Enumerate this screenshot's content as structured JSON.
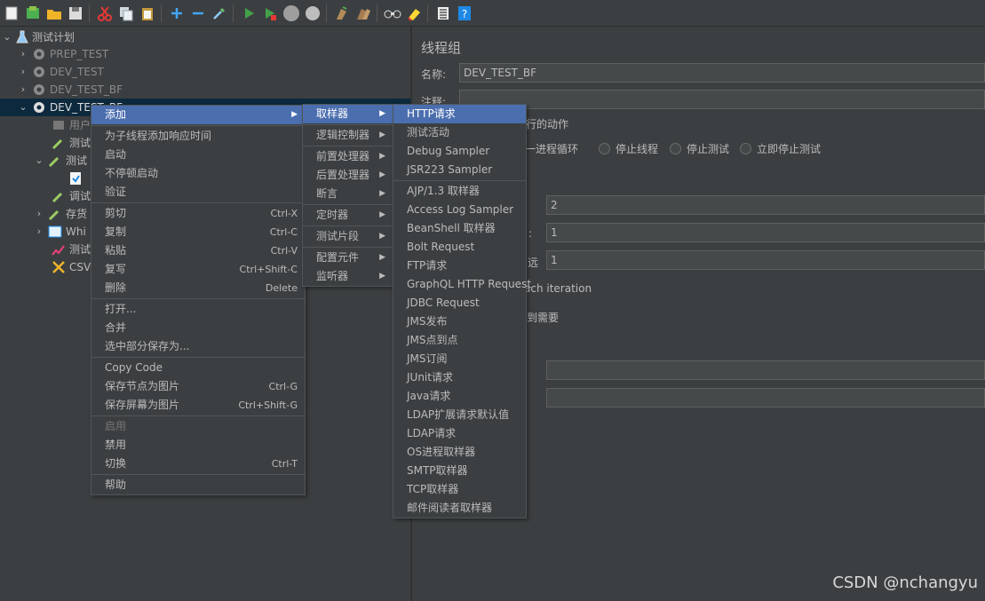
{
  "toolbar": {
    "buttons": [
      "new-icon",
      "templates-icon",
      "open-icon",
      "save-icon",
      "cut-icon",
      "copy-icon",
      "paste-icon",
      "expand-icon",
      "collapse-icon",
      "toggle-icon",
      "start-icon",
      "start-no-pause-icon",
      "stop-icon",
      "shutdown-icon",
      "clear-icon",
      "clear-all-icon",
      "search-icon",
      "reset-search-icon",
      "function-helper-icon",
      "help-icon"
    ]
  },
  "tree": {
    "root": "测试计划",
    "items": [
      "PREP_TEST",
      "DEV_TEST",
      "DEV_TEST_BF",
      "DEV_TEST_BF"
    ],
    "children": [
      "用户",
      "测试",
      "测试",
      "调试",
      "存货",
      "Whi",
      "测试",
      "CSV"
    ]
  },
  "panel": {
    "title": "线程组",
    "name_label": "名称:",
    "name_value": "DEV_TEST_BF",
    "comment_label": "注释:",
    "action_label": "行的动作",
    "radios": [
      "下一进程循环",
      "停止线程",
      "停止测试",
      "立即停止测试"
    ],
    "field1_value": "2",
    "field2_label": ":",
    "field2_value": "1",
    "field3_label": "远",
    "field3_value": "1",
    "iteration_text": "ach iteration",
    "need_text": "到需要"
  },
  "context_menu": {
    "items": [
      {
        "label": "添加",
        "accel": "",
        "sub": true,
        "selected": true
      },
      {
        "sep": true
      },
      {
        "label": "为子线程添加响应时间",
        "accel": ""
      },
      {
        "label": "启动",
        "accel": ""
      },
      {
        "label": "不停顿启动",
        "accel": ""
      },
      {
        "label": "验证",
        "accel": ""
      },
      {
        "sep": true
      },
      {
        "label": "剪切",
        "accel": "Ctrl-X"
      },
      {
        "label": "复制",
        "accel": "Ctrl-C"
      },
      {
        "label": "粘贴",
        "accel": "Ctrl-V"
      },
      {
        "label": "复写",
        "accel": "Ctrl+Shift-C"
      },
      {
        "label": "删除",
        "accel": "Delete"
      },
      {
        "sep": true
      },
      {
        "label": "打开...",
        "accel": ""
      },
      {
        "label": "合并",
        "accel": ""
      },
      {
        "label": "选中部分保存为...",
        "accel": ""
      },
      {
        "sep": true
      },
      {
        "label": "Copy Code",
        "accel": ""
      },
      {
        "label": "保存节点为图片",
        "accel": "Ctrl-G"
      },
      {
        "label": "保存屏幕为图片",
        "accel": "Ctrl+Shift-G"
      },
      {
        "sep": true
      },
      {
        "label": "启用",
        "accel": "",
        "disabled": true
      },
      {
        "label": "禁用",
        "accel": ""
      },
      {
        "label": "切换",
        "accel": "Ctrl-T"
      },
      {
        "sep": true
      },
      {
        "label": "帮助",
        "accel": ""
      }
    ]
  },
  "add_submenu": {
    "items": [
      {
        "label": "取样器",
        "sub": true,
        "selected": true
      },
      {
        "sep": true
      },
      {
        "label": "逻辑控制器",
        "sub": true
      },
      {
        "sep": true
      },
      {
        "label": "前置处理器",
        "sub": true
      },
      {
        "label": "后置处理器",
        "sub": true
      },
      {
        "label": "断言",
        "sub": true
      },
      {
        "sep": true
      },
      {
        "label": "定时器",
        "sub": true
      },
      {
        "sep": true
      },
      {
        "label": "测试片段",
        "sub": true
      },
      {
        "sep": true
      },
      {
        "label": "配置元件",
        "sub": true
      },
      {
        "label": "监听器",
        "sub": true
      }
    ]
  },
  "sampler_submenu": {
    "items": [
      {
        "label": "HTTP请求",
        "selected": true
      },
      {
        "label": "测试活动"
      },
      {
        "label": "Debug Sampler"
      },
      {
        "label": "JSR223 Sampler"
      },
      {
        "sep": true
      },
      {
        "label": "AJP/1.3 取样器"
      },
      {
        "label": "Access Log Sampler"
      },
      {
        "label": "BeanShell 取样器"
      },
      {
        "label": "Bolt Request"
      },
      {
        "label": "FTP请求"
      },
      {
        "label": "GraphQL HTTP Request"
      },
      {
        "label": "JDBC Request"
      },
      {
        "label": "JMS发布"
      },
      {
        "label": "JMS点到点"
      },
      {
        "label": "JMS订阅"
      },
      {
        "label": "JUnit请求"
      },
      {
        "label": "Java请求"
      },
      {
        "label": "LDAP扩展请求默认值"
      },
      {
        "label": "LDAP请求"
      },
      {
        "label": "OS进程取样器"
      },
      {
        "label": "SMTP取样器"
      },
      {
        "label": "TCP取样器"
      },
      {
        "label": "邮件阅读者取样器"
      }
    ]
  },
  "watermark": "CSDN @nchangyu"
}
